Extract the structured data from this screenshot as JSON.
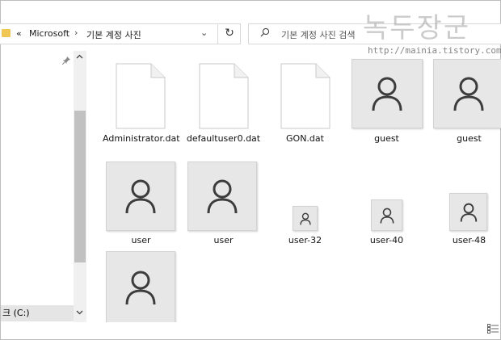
{
  "address_bar": {
    "overflow": "«",
    "crumbs": [
      "Microsoft",
      "기본 계정 사진"
    ],
    "separator": "›",
    "dropdown": "⌄",
    "refresh": "↻"
  },
  "search": {
    "icon": "search-icon",
    "placeholder": "기본 계정 사진 검색"
  },
  "watermark": {
    "title": "녹두장군",
    "url": "http://mainia.tistory.com"
  },
  "navigation": {
    "drive_label": "크 (C:)"
  },
  "files": [
    {
      "name": "Administrator.dat",
      "kind": "document"
    },
    {
      "name": "defaultuser0.dat",
      "kind": "document"
    },
    {
      "name": "GON.dat",
      "kind": "document"
    },
    {
      "name": "guest",
      "kind": "user-image"
    },
    {
      "name": "guest",
      "kind": "user-image"
    },
    {
      "name": "user",
      "kind": "user-image"
    },
    {
      "name": "user",
      "kind": "user-image"
    },
    {
      "name": "user-32",
      "kind": "user-image"
    },
    {
      "name": "user-40",
      "kind": "user-image"
    },
    {
      "name": "user-48",
      "kind": "user-image"
    },
    {
      "name": "",
      "kind": "user-image"
    }
  ]
}
